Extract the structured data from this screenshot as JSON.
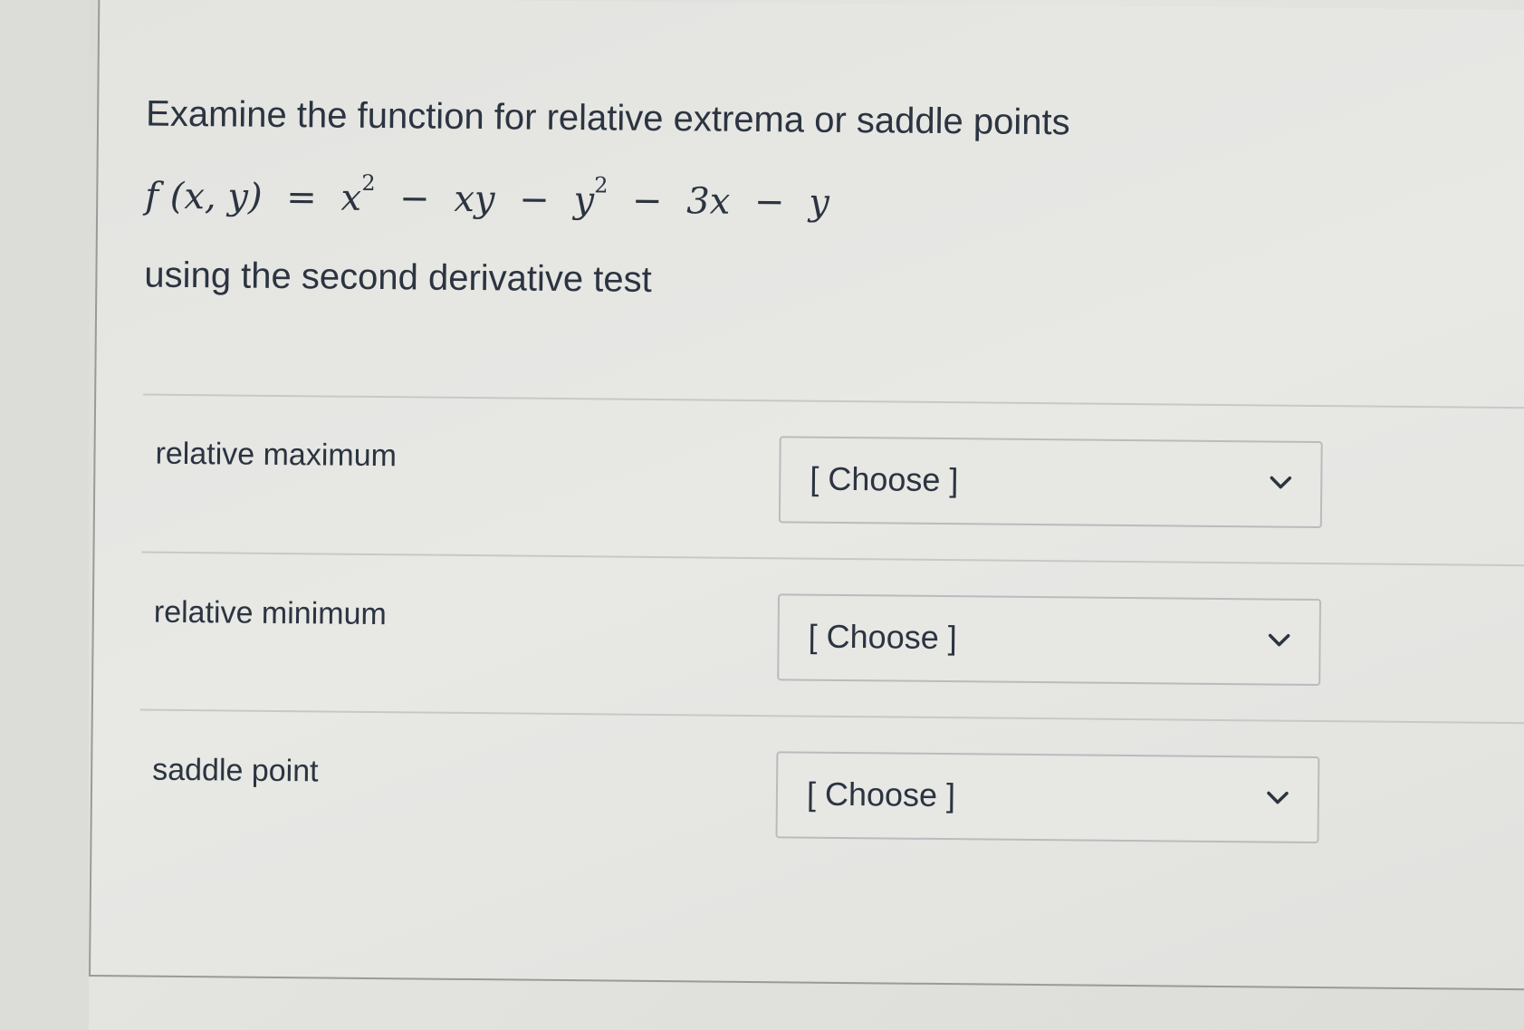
{
  "question": {
    "title": "Examine the function for relative extrema or saddle points",
    "formula": {
      "lhs": "f (x, y)",
      "eq": "=",
      "t1": "x",
      "t1_exp": "2",
      "m1": "−",
      "t2": "xy",
      "m2": "−",
      "t3": "y",
      "t3_exp": "2",
      "m3": "−",
      "t4": "3x",
      "m4": "−",
      "t5": "y"
    },
    "subtitle": "using the second derivative test"
  },
  "answers": [
    {
      "label": "relative maximum",
      "select_value": "[ Choose ]",
      "icon": "chevron-down-icon"
    },
    {
      "label": "relative minimum",
      "select_value": "[ Choose ]",
      "icon": "chevron-down-icon"
    },
    {
      "label": "saddle point",
      "select_value": "[ Choose ]",
      "icon": "chevron-down-icon"
    }
  ]
}
